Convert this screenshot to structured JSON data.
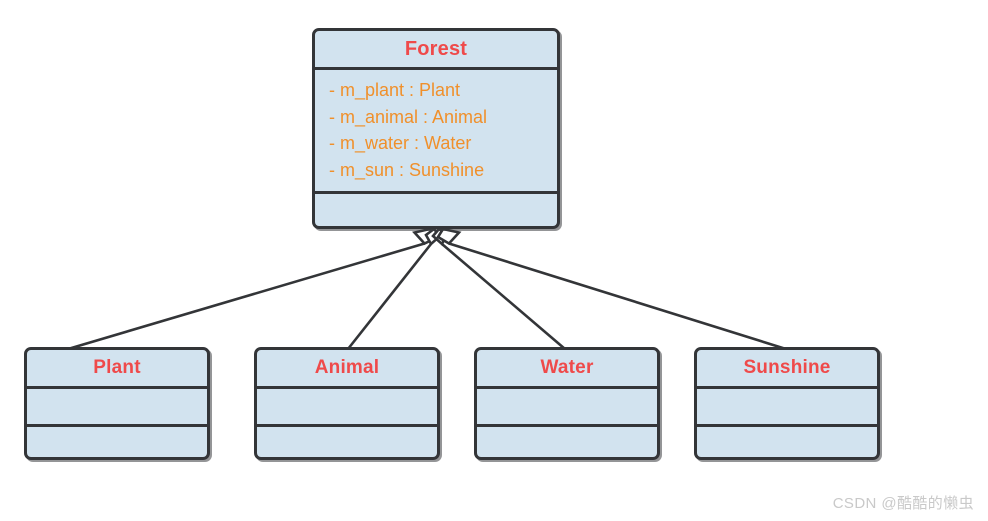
{
  "diagram": {
    "type": "uml-class-diagram",
    "relationship": "aggregation",
    "colors": {
      "box_fill": "#d2e3ef",
      "box_border": "#333538",
      "class_name": "#ef4a4a",
      "attribute": "#f0902b",
      "connector": "#333538",
      "background": "#ffffff",
      "watermark": "#c9c9c9"
    },
    "classes": [
      {
        "id": "forest",
        "name": "Forest",
        "attributes": [
          "- m_plant : Plant",
          "- m_animal : Animal",
          "- m_water : Water",
          "- m_sun : Sunshine"
        ],
        "operations": []
      },
      {
        "id": "plant",
        "name": "Plant",
        "attributes": [],
        "operations": []
      },
      {
        "id": "animal",
        "name": "Animal",
        "attributes": [],
        "operations": []
      },
      {
        "id": "water",
        "name": "Water",
        "attributes": [],
        "operations": []
      },
      {
        "id": "sunshine",
        "name": "Sunshine",
        "attributes": [],
        "operations": []
      }
    ],
    "connectors": [
      {
        "from": "forest",
        "to": "plant",
        "kind": "aggregation",
        "diamond_end": "forest"
      },
      {
        "from": "forest",
        "to": "animal",
        "kind": "aggregation",
        "diamond_end": "forest"
      },
      {
        "from": "forest",
        "to": "water",
        "kind": "aggregation",
        "diamond_end": "forest"
      },
      {
        "from": "forest",
        "to": "sunshine",
        "kind": "aggregation",
        "diamond_end": "forest"
      }
    ]
  },
  "watermark": {
    "text": "CSDN @酷酷的懒虫"
  }
}
